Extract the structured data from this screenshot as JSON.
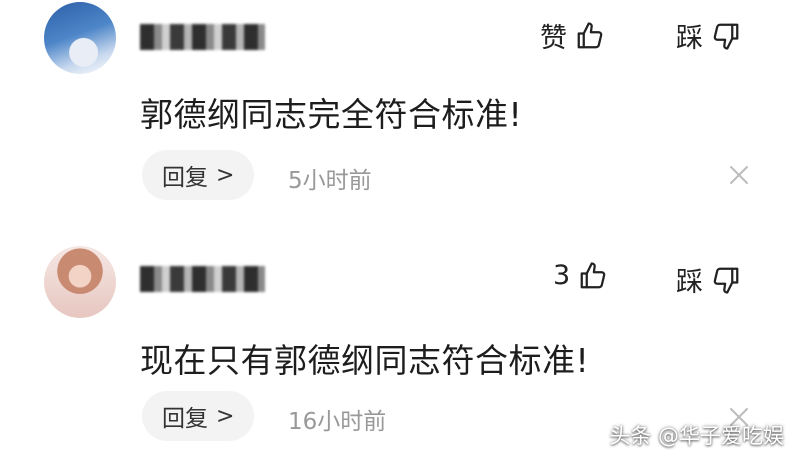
{
  "comments": [
    {
      "username": "",
      "like_label": "赞",
      "dislike_label": "踩",
      "text": "郭德纲同志完全符合标准!",
      "reply_label": "回复",
      "reply_chevron": ">",
      "time": "5小时前"
    },
    {
      "username": "",
      "like_label": "3",
      "dislike_label": "踩",
      "text": "现在只有郭德纲同志符合标准!",
      "reply_label": "回复",
      "reply_chevron": ">",
      "time": "16小时前"
    }
  ],
  "watermark": "头条 @华子爱吃娱",
  "icons": {
    "like": "thumbs-up-icon",
    "dislike": "thumbs-down-icon",
    "close": "close-icon"
  }
}
